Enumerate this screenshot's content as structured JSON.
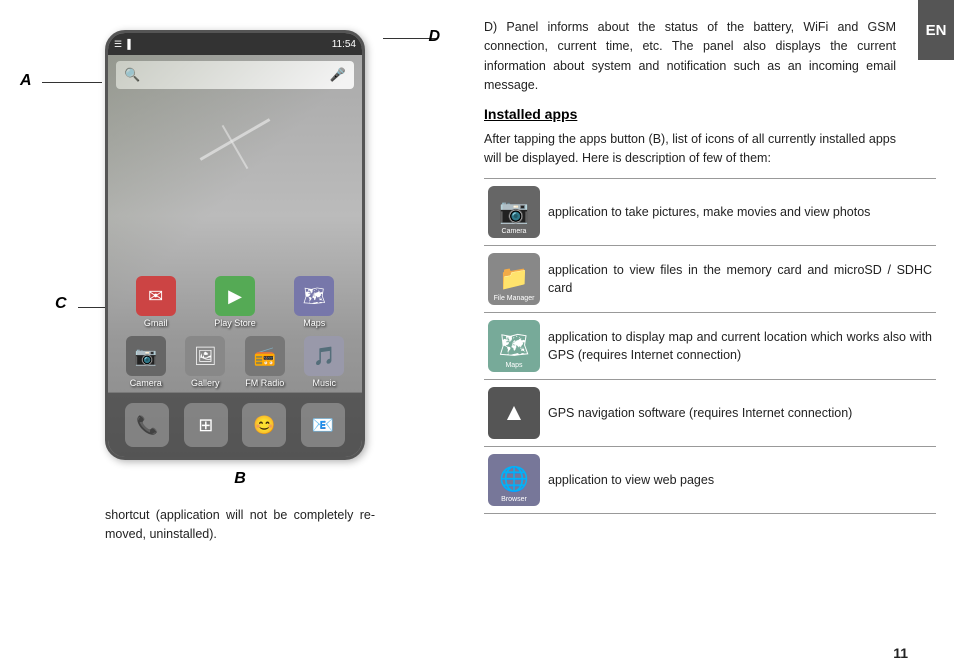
{
  "left": {
    "phone": {
      "status_time": "11:54",
      "search_placeholder": "🔍",
      "mic_icon": "🎤",
      "apps_row1": [
        {
          "label": "Gmail",
          "icon": "✉"
        },
        {
          "label": "Play Store",
          "icon": "▶"
        },
        {
          "label": "Maps",
          "icon": "🗺"
        }
      ],
      "apps_row2": [
        {
          "label": "Camera",
          "icon": "📷"
        },
        {
          "label": "Gallery",
          "icon": "🖼"
        },
        {
          "label": "FM Radio",
          "icon": "📻"
        },
        {
          "label": "Music",
          "icon": "🎵"
        }
      ],
      "dock": [
        {
          "icon": "📞"
        },
        {
          "icon": "⊞"
        },
        {
          "icon": "😊"
        },
        {
          "icon": "📧"
        }
      ]
    },
    "labels": {
      "A": "A",
      "B": "B",
      "C": "C",
      "D": "D"
    },
    "caption": "shortcut (application will not be completely re-moved, uninstalled)."
  },
  "right": {
    "lang": "EN",
    "intro_text": "D) Panel informs about the status of the battery, WiFi and GSM connection, current time, etc. The panel also displays the current information about system and notification such as an incoming email message.",
    "section_title": "Installed apps",
    "section_intro": "After tapping the apps button (B), list of icons of all currently installed apps will be displayed. Here is description of few of them:",
    "apps": [
      {
        "icon_symbol": "📷",
        "icon_label": "Camera",
        "icon_type": "camera",
        "description": "application to take pictures, make movies and view photos"
      },
      {
        "icon_symbol": "📁",
        "icon_label": "File Manager",
        "icon_type": "filemanager",
        "description": "application to view files in the memory card and microSD / SDHC card"
      },
      {
        "icon_symbol": "🗺",
        "icon_label": "Maps",
        "icon_type": "maps",
        "description": "application to display map and current location which works also with GPS (requires Internet connection)"
      },
      {
        "icon_symbol": "▲",
        "icon_label": "",
        "icon_type": "gps",
        "description": "GPS navigation software (requires Internet connection)"
      },
      {
        "icon_symbol": "🌐",
        "icon_label": "Browser",
        "icon_type": "browser",
        "description": "application to view web pages"
      }
    ],
    "page_number": "11"
  }
}
